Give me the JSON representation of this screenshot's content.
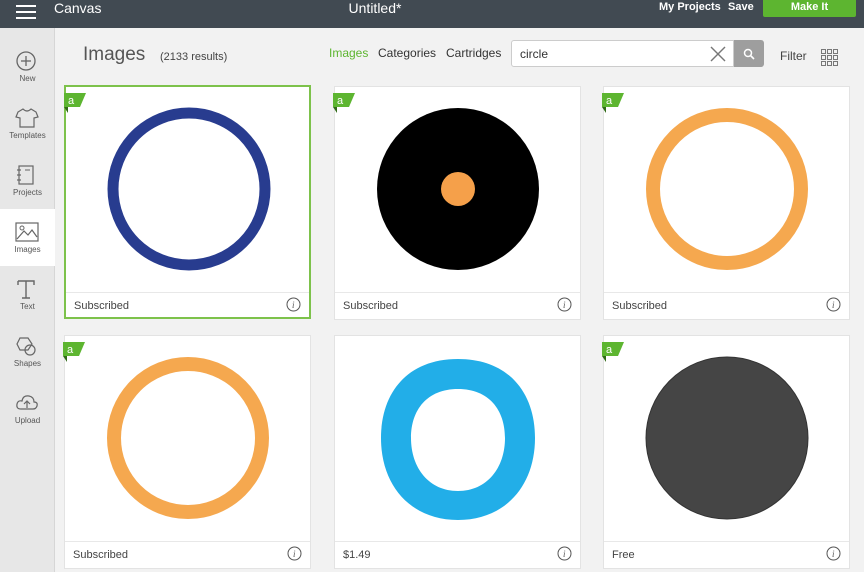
{
  "topbar": {
    "app_title": "Canvas",
    "document_title": "Untitled*",
    "my_projects": "My Projects",
    "save": "Save",
    "make_it": "Make It"
  },
  "sidebar": {
    "items": [
      {
        "label": "New",
        "icon": "plus-circle-icon"
      },
      {
        "label": "Templates",
        "icon": "tshirt-icon"
      },
      {
        "label": "Projects",
        "icon": "notebook-icon"
      },
      {
        "label": "Images",
        "icon": "image-icon",
        "active": true
      },
      {
        "label": "Text",
        "icon": "text-t-icon"
      },
      {
        "label": "Shapes",
        "icon": "shapes-icon"
      },
      {
        "label": "Upload",
        "icon": "cloud-upload-icon"
      }
    ]
  },
  "header": {
    "title": "Images",
    "results": "(2133 results)",
    "tabs": [
      "Images",
      "Categories",
      "Cartridges"
    ],
    "active_tab": "Images",
    "search_value": "circle",
    "filter": "Filter"
  },
  "colors": {
    "accent_green": "#5db530",
    "topbar": "#414a52"
  },
  "cards": [
    {
      "caption": "Subscribed",
      "badge": "a",
      "image": "navy circle outline",
      "selected": true
    },
    {
      "caption": "Subscribed",
      "badge": "a",
      "image": "black disc with orange center dot"
    },
    {
      "caption": "Subscribed",
      "badge": "a",
      "image": "orange circle outline"
    },
    {
      "caption": "Subscribed",
      "badge": "a",
      "image": "orange circle outline"
    },
    {
      "caption": "$1.49",
      "badge": "",
      "image": "blue rounded squircle ring"
    },
    {
      "caption": "Free",
      "badge": "a",
      "image": "dark gray filled circle"
    }
  ]
}
